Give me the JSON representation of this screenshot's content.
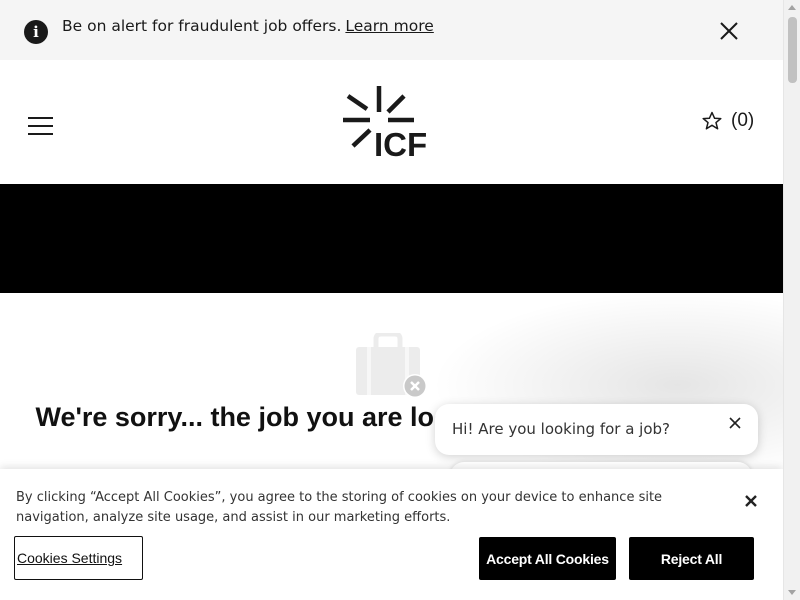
{
  "alert": {
    "icon": "info-icon",
    "message": "Be on alert for fraudulent job offers.",
    "link_text": "Learn more"
  },
  "header": {
    "logo_text": "ICF",
    "saved_count": "(0)",
    "menu_icon": "hamburger-menu-icon",
    "saved_icon": "star-icon"
  },
  "main": {
    "illustration_icon": "briefcase-closed-icon",
    "message": "We're sorry... the job you are looking for has been filled"
  },
  "chat": {
    "greeting": "Hi! Are you looking for a job?"
  },
  "cookie_banner": {
    "text": "By clicking “Accept All Cookies”, you agree to the storing of cookies on your device to enhance site navigation, analyze site usage, and assist in our marketing efforts.",
    "settings_label": "Cookies Settings",
    "accept_label": "Accept All Cookies",
    "reject_label": "Reject All"
  },
  "colors": {
    "brand_black": "#000000",
    "alert_bg": "#f5f5f5"
  }
}
